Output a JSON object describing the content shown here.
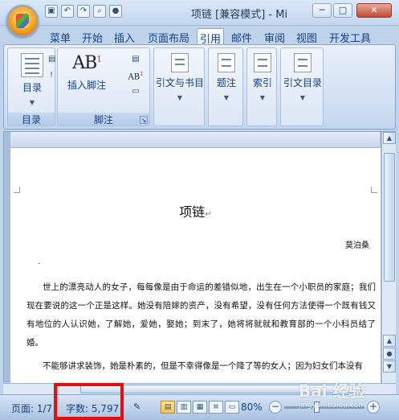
{
  "window": {
    "title": "项链 [兼容模式] - Mi",
    "min_label": "─",
    "max_label": "□",
    "close_label": "✕"
  },
  "qat": [
    "save-icon",
    "undo-icon",
    "redo-icon",
    "print-preview-icon",
    "spellcheck-icon"
  ],
  "tabs": [
    {
      "label": "菜单",
      "active": false
    },
    {
      "label": "开始",
      "active": false
    },
    {
      "label": "插入",
      "active": false
    },
    {
      "label": "页面布局",
      "active": false
    },
    {
      "label": "引用",
      "active": true
    },
    {
      "label": "邮件",
      "active": false
    },
    {
      "label": "审阅",
      "active": false
    },
    {
      "label": "视图",
      "active": false
    },
    {
      "label": "开发工具",
      "active": false
    }
  ],
  "ribbon": {
    "groups": [
      {
        "label": "目录",
        "buttons": [
          {
            "label": "目录"
          }
        ]
      },
      {
        "label": "脚注",
        "buttons": [
          {
            "label": "插入脚注"
          }
        ]
      },
      {
        "label": "",
        "buttons": [
          {
            "label": "引文与书目"
          }
        ]
      },
      {
        "label": "",
        "buttons": [
          {
            "label": "题注"
          }
        ]
      },
      {
        "label": "",
        "buttons": [
          {
            "label": "索引"
          }
        ]
      },
      {
        "label": "",
        "buttons": [
          {
            "label": "引文目录"
          }
        ]
      }
    ],
    "footnote_icon_text": "AB",
    "footnote_icon_sup": "1",
    "small_ab_text": "AB",
    "small_ab_sup": "1"
  },
  "document": {
    "title": "项链",
    "author": "莫泊桑",
    "small_mark": ".",
    "paragraph1": "世上的漂亮动人的女子，每每像是由于命运的差错似地，出生在一个小职员的家庭；我们现在要说的这一个正是这样。她没有陪嫁的资产，没有希望，没有任何方法使得一个既有钱又有地位的人认识她，了解她，爱她，娶她；到末了，她将将就就和教育部的一个小科员结了婚。",
    "paragraph2": "不能够讲求装饰，她是朴素的，但是不幸得像是一个降了等的女人；因为妇女们本没有"
  },
  "statusbar": {
    "page": "页面: 1/7",
    "word_count": "字数: 5,797",
    "zoom": "80%",
    "zoom_minus": "−",
    "zoom_plus": "+",
    "zoom_level": 0.4
  },
  "watermark": {
    "text": "Bai 经验",
    "url": "jingyan.baidu.com"
  }
}
